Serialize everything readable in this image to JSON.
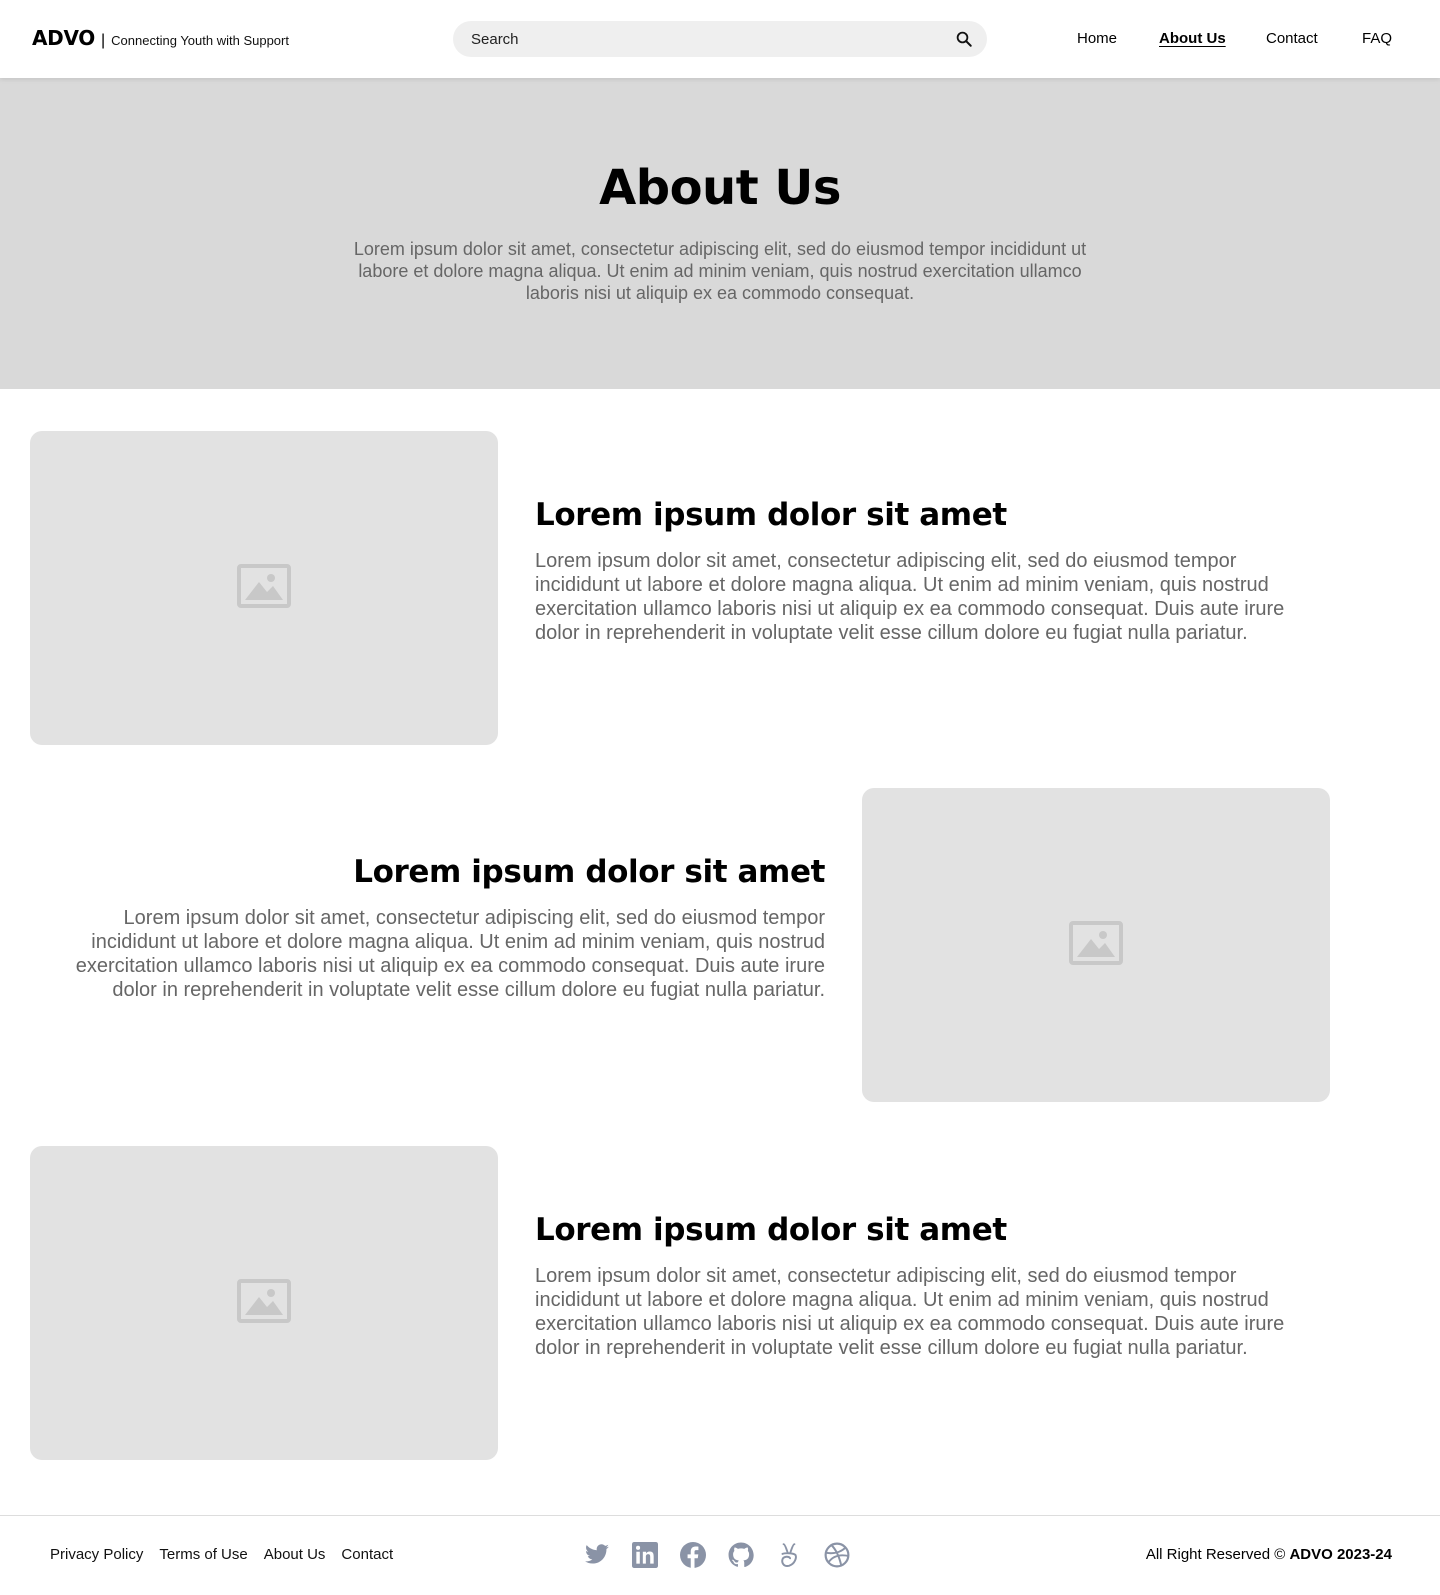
{
  "header": {
    "brand_name": "ADVO",
    "brand_separator": "|",
    "brand_tagline": "Connecting Youth with Support",
    "search_placeholder": "Search",
    "nav": [
      {
        "label": "Home",
        "active": false
      },
      {
        "label": "About Us",
        "active": true
      },
      {
        "label": "Contact",
        "active": false
      },
      {
        "label": "FAQ",
        "active": false
      }
    ]
  },
  "hero": {
    "title": "About Us",
    "text": "Lorem ipsum dolor sit amet, consectetur adipiscing elit, sed do eiusmod tempor incididunt ut labore et dolore magna aliqua. Ut enim ad minim veniam, quis nostrud exercitation ullamco laboris nisi ut aliquip ex ea commodo consequat."
  },
  "features": [
    {
      "title": "Lorem ipsum dolor sit amet",
      "text": "Lorem ipsum dolor sit amet, consectetur adipiscing elit, sed do eiusmod tempor incididunt ut labore et dolore magna aliqua. Ut enim ad minim veniam, quis nostrud exercitation ullamco laboris nisi ut aliquip ex ea commodo consequat. Duis aute irure dolor in reprehenderit in voluptate velit esse cillum dolore eu fugiat nulla pariatur."
    },
    {
      "title": "Lorem ipsum dolor sit amet",
      "text": "Lorem ipsum dolor sit amet, consectetur adipiscing elit, sed do eiusmod tempor incididunt ut labore et dolore magna aliqua. Ut enim ad minim veniam, quis nostrud exercitation ullamco laboris nisi ut aliquip ex ea commodo consequat. Duis aute irure dolor in reprehenderit in voluptate velit esse cillum dolore eu fugiat nulla pariatur."
    },
    {
      "title": "Lorem ipsum dolor sit amet",
      "text": "Lorem ipsum dolor sit amet, consectetur adipiscing elit, sed do eiusmod tempor incididunt ut labore et dolore magna aliqua. Ut enim ad minim veniam, quis nostrud exercitation ullamco laboris nisi ut aliquip ex ea commodo consequat. Duis aute irure dolor in reprehenderit in voluptate velit esse cillum dolore eu fugiat nulla pariatur."
    }
  ],
  "footer": {
    "links": [
      "Privacy Policy",
      "Terms of Use",
      "About Us",
      "Contact"
    ],
    "socials": [
      "twitter-icon",
      "linkedin-icon",
      "facebook-icon",
      "github-icon",
      "angellist-icon",
      "dribbble-icon"
    ],
    "copyright_prefix": "All Right Reserved ©",
    "copyright_brand": "ADVO 2023-24"
  },
  "colors": {
    "hero_bg": "#d9d9d9",
    "placeholder_bg": "#e2e2e2",
    "body_text_gray": "#666666",
    "social_icon": "#8a93a6"
  }
}
